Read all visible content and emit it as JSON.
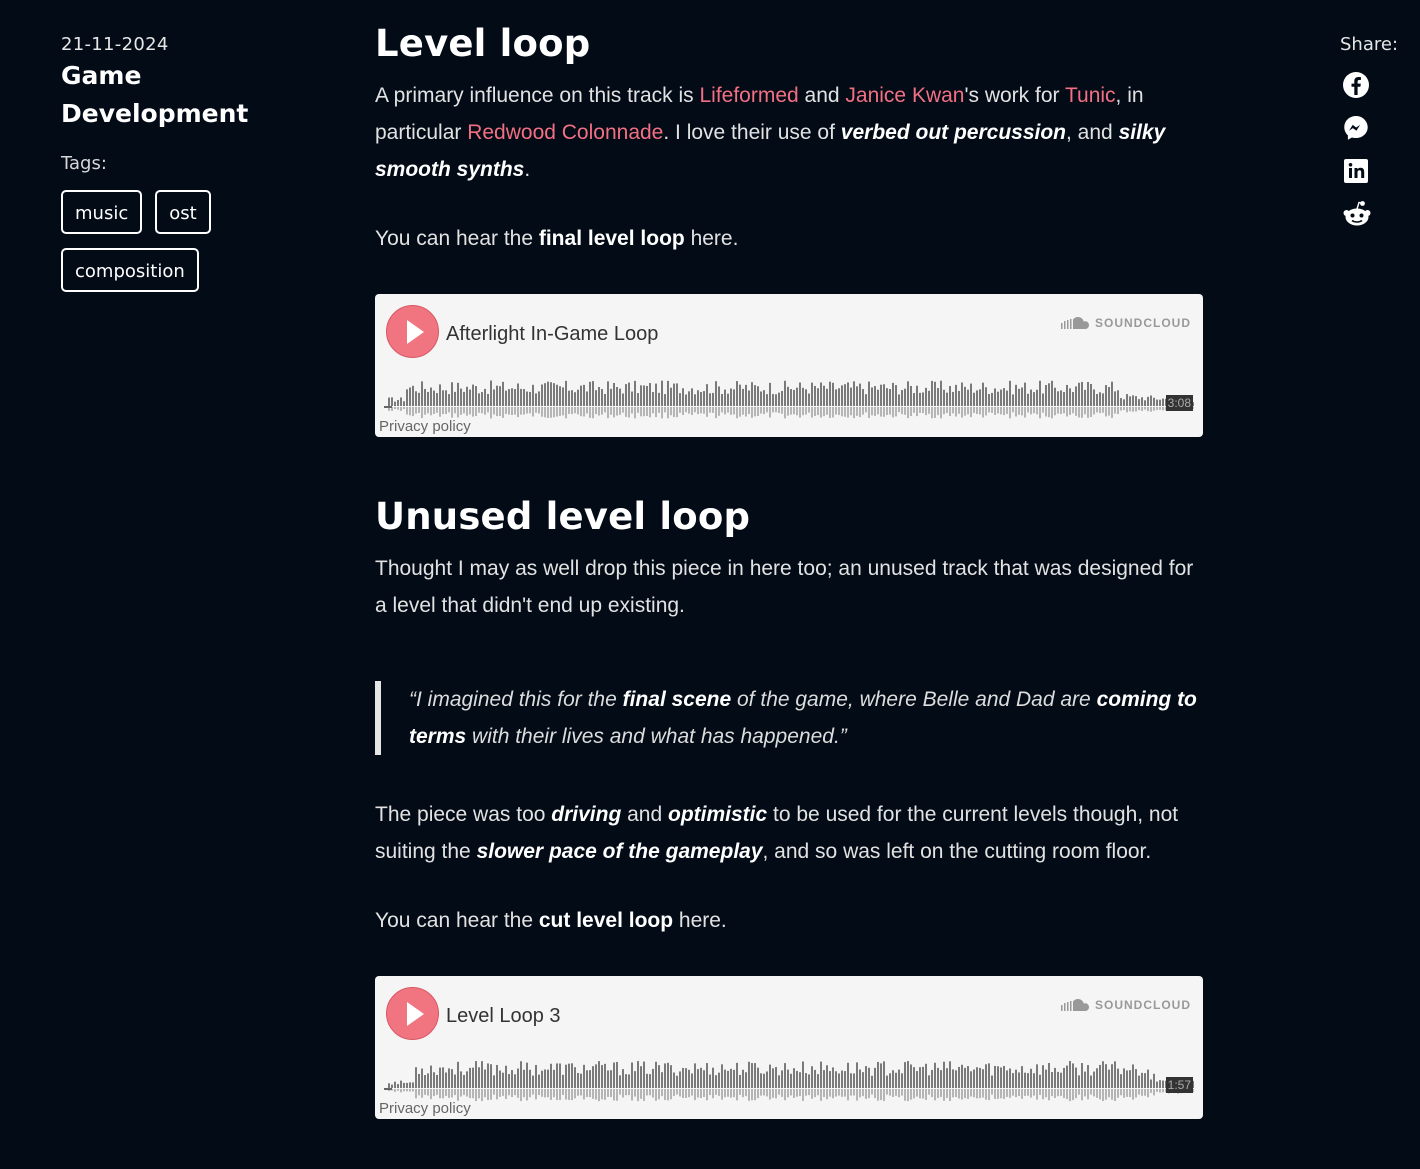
{
  "sidebar": {
    "date": "21-11-2024",
    "category": "Game Development",
    "tags_label": "Tags:",
    "tags": [
      "music",
      "ost",
      "composition"
    ]
  },
  "share": {
    "label": "Share:",
    "icons": [
      "facebook-icon",
      "messenger-icon",
      "linkedin-icon",
      "reddit-icon"
    ]
  },
  "section1": {
    "heading": "Level loop",
    "p1": {
      "t1": "A primary influence on this track is ",
      "link1": "Lifeformed",
      "t2": " and ",
      "link2": "Janice Kwan",
      "t3": "'s work for ",
      "link3": "Tunic",
      "t4": ", in particular ",
      "link4": "Redwood Colonnade",
      "t5": ". I love their use of ",
      "em1": "verbed out percussion",
      "t6": ", and ",
      "em2": "silky smooth synths",
      "t7": "."
    },
    "p2": {
      "t1": "You can hear the ",
      "b1": "final level loop",
      "t2": " here."
    },
    "player": {
      "title": "Afterlight In-Game Loop",
      "brand": "SOUNDCLOUD",
      "duration": "3:08",
      "privacy": "Privacy policy"
    }
  },
  "section2": {
    "heading": "Unused level loop",
    "p1": "Thought I may as well drop this piece in here too; an unused track that was designed for a level that didn't end up existing.",
    "quote": {
      "t1": "“I imagined this for the ",
      "b1": "final scene",
      "t2": " of the game, where Belle and Dad are ",
      "b2": "coming to terms",
      "t3": " with their lives and what has happened.”"
    },
    "p2": {
      "t1": "The piece was too ",
      "em1": "driving",
      "t2": " and ",
      "em2": "optimistic",
      "t3": " to be used for the current levels though, not suiting the ",
      "em3": "slower pace of the gameplay",
      "t4": ", and so was left on the cutting room floor."
    },
    "p3": {
      "t1": "You can hear the ",
      "b1": "cut level loop",
      "t2": " here."
    },
    "player": {
      "title": "Level Loop 3",
      "brand": "SOUNDCLOUD",
      "duration": "1:57",
      "privacy": "Privacy policy"
    }
  },
  "colors": {
    "background": "#020b16",
    "link": "#f27083",
    "play_button": "#f07581"
  }
}
